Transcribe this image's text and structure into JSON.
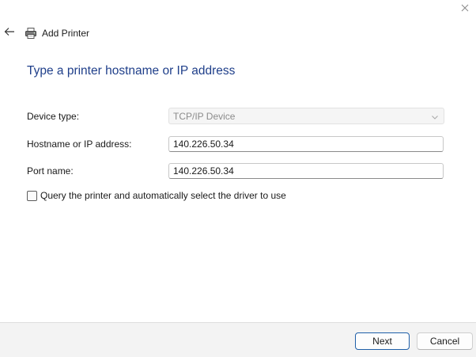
{
  "window": {
    "title": "Add Printer",
    "icons": {
      "back": "arrow-left-icon",
      "close": "close-icon",
      "printer": "printer-icon"
    }
  },
  "heading": "Type a printer hostname or IP address",
  "form": {
    "device_type": {
      "label": "Device type:",
      "selected": "TCP/IP Device",
      "disabled": true
    },
    "hostname": {
      "label": "Hostname or IP address:",
      "value": "140.226.50.34"
    },
    "port": {
      "label": "Port name:",
      "value": "140.226.50.34"
    },
    "query_checkbox": {
      "label": "Query the printer and automatically select the driver to use",
      "checked": false
    }
  },
  "footer": {
    "next_label": "Next",
    "cancel_label": "Cancel"
  },
  "colors": {
    "heading": "#1f3f8a",
    "primary_border": "#1f5fa8",
    "footer_bg": "#f3f3f3"
  }
}
